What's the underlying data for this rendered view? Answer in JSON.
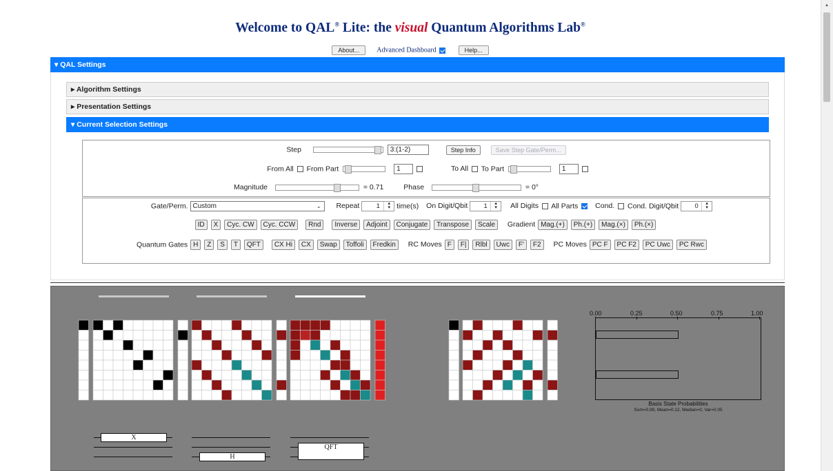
{
  "header": {
    "title_prefix": "Welcome to QAL",
    "title_sup": "®",
    "title_mid": " Lite: the ",
    "title_visual": "visual",
    "title_suffix": " Quantum Algorithms Lab",
    "about_btn": "About...",
    "advanced_label": "Advanced Dashboard",
    "advanced_checked": true,
    "help_btn": "Help..."
  },
  "settings": {
    "main_label": "QAL Settings",
    "algorithm_label": "Algorithm Settings",
    "presentation_label": "Presentation Settings",
    "current_label": "Current Selection Settings",
    "step_label": "Step",
    "step_value": "3:(1-2)",
    "step_info_btn": "Step Info",
    "save_btn": "Save Step Gate/Perm...",
    "from_all": "From All",
    "from_part": "From Part",
    "from_value": "1",
    "to_all": "To All",
    "to_part": "To Part",
    "to_value": "1",
    "magnitude_label": "Magnitude",
    "magnitude_value": "= 0.71",
    "phase_label": "Phase",
    "phase_value": "= 0°",
    "gateperm_label": "Gate/Perm.",
    "gateperm_value": "Custom",
    "repeat_label": "Repeat",
    "repeat_value": "1",
    "times_label": "time(s)",
    "on_digit_label": "On Digit/Qbit",
    "on_digit_value": "1",
    "all_digits": "All Digits",
    "all_parts": "All Parts",
    "cond_label": "Cond.",
    "cond_digit_label": "Cond. Digit/Qbit",
    "cond_digit_value": "0",
    "perm_buttons_a": [
      "ID",
      "X",
      "Cyc. CW",
      "Cyc. CCW"
    ],
    "rnd_btn": "Rnd",
    "perm_buttons_b": [
      "Inverse",
      "Adjoint",
      "Conjugate",
      "Transpose",
      "Scale"
    ],
    "gradient_label": "Gradient",
    "gradient_buttons": [
      "Mag.(+)",
      "Ph.(+)",
      "Mag.(×)",
      "Ph.(×)"
    ],
    "quantum_gates_label": "Quantum Gates",
    "quantum_gates": [
      "H",
      "Z",
      "S",
      "T",
      "QFT"
    ],
    "cx_gates": [
      "CX Hi",
      "CX",
      "Swap",
      "Toffoli",
      "Fredkin"
    ],
    "rc_moves_label": "RC Moves",
    "rc_moves": [
      "F",
      "F|",
      "Rlbl",
      "Uwc",
      "F'",
      "F2"
    ],
    "pc_moves_label": "PC Moves",
    "pc_moves": [
      "PC F",
      "PC F2",
      "PC Uwc",
      "PC Rwc"
    ]
  },
  "viz": {
    "circuit_labels": [
      "X",
      "H",
      "QFT"
    ],
    "prob_axis": [
      "0.00",
      "0.25",
      "0.50",
      "0.75",
      "1.00"
    ],
    "prob_bar_values": [
      0.5,
      0.5
    ],
    "prob_title": "Basis State Probabilities",
    "prob_stats": "Sum=0.99, Mean=0.12, Median=0, Var=0.05",
    "colors": {
      "black": "#000000",
      "darkred": "#8b1414",
      "teal": "#1a8a8a",
      "red": "#e02020",
      "bg": "#808080",
      "accent": "#0a7cff"
    }
  }
}
